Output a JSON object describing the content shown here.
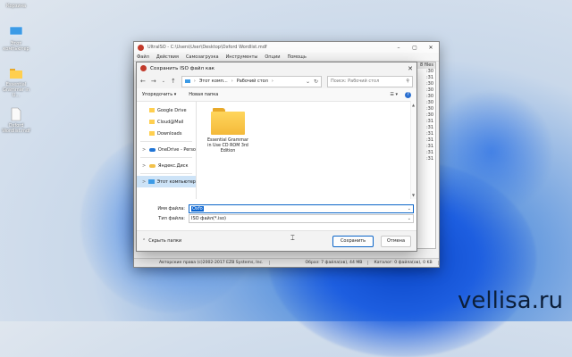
{
  "desktop": {
    "icons": [
      {
        "label": "Корзина",
        "icon": "recycle-bin-icon"
      },
      {
        "label": "Этот компьютер",
        "icon": "computer-icon"
      },
      {
        "label": "Essential Grammar in U...",
        "icon": "folder-icon"
      },
      {
        "label": "Oxford Wordlist.mdf",
        "icon": "file-icon"
      }
    ],
    "watermark": "vellisa.ru"
  },
  "ultraiso": {
    "title": "UltraISO - C:\\Users\\User\\Desktop\\Oxford Wordlist.mdf",
    "menu": [
      "Файл",
      "Действия",
      "Самозагрузка",
      "Инструменты",
      "Опции",
      "Помощь"
    ],
    "right_panel": [
      "8 files",
      ":30",
      ":31",
      ":30",
      ":30",
      ":30",
      ":30",
      ":30",
      ":30",
      ":31",
      ":31",
      ":31",
      ":31",
      ":31",
      ":31",
      ":31"
    ],
    "status": [
      "Авторские права (c)2002-2017 EZB Systems, Inc.",
      "Образ: 7 файла(ов), 44 MB",
      "Каталог: 0 файла(ов), 0 KB"
    ]
  },
  "dialog": {
    "title": "Сохранить ISO файл как",
    "breadcrumb": [
      "Этот комп...",
      "Рабочий стол"
    ],
    "search_placeholder": "Поиск: Рабочий стол",
    "organize": "Упорядочить ▾",
    "new_folder": "Новая папка",
    "sidebar": [
      {
        "label": "Google Drive",
        "icon": "folder-icon",
        "chev": ""
      },
      {
        "label": "Cloud@Mail",
        "icon": "folder-icon",
        "chev": ""
      },
      {
        "label": "Downloads",
        "icon": "folder-icon",
        "chev": ""
      },
      {
        "label": "OneDrive - Perso",
        "icon": "onedrive-icon",
        "chev": ">"
      },
      {
        "label": "Яндекс.Диск",
        "icon": "cloud-icon",
        "chev": ">"
      },
      {
        "label": "Этот компьютер",
        "icon": "computer-icon",
        "chev": ">"
      }
    ],
    "files": [
      {
        "name": "Essential Grammar in Use CD ROM 3rd Edition",
        "icon": "folder-icon"
      }
    ],
    "filename_label": "Имя файла:",
    "filename_value": "Oxfo",
    "filetype_label": "Тип файла:",
    "filetype_value": "ISO файл(*.iso)",
    "hide_folders": "Скрыть папки",
    "save_button": "Сохранить",
    "cancel_button": "Отмена"
  }
}
